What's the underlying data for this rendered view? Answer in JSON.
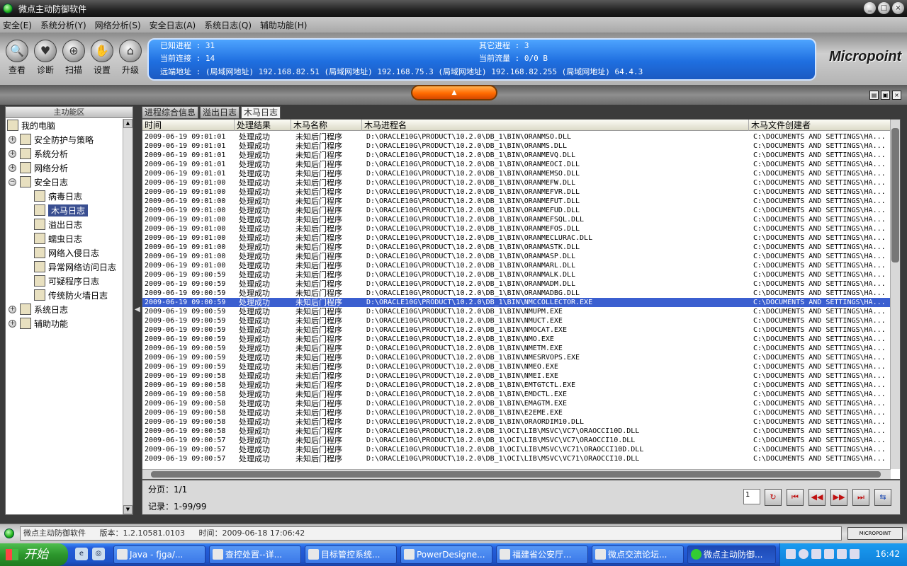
{
  "window": {
    "title": "微点主动防御软件",
    "buttons": [
      "_",
      "□",
      "×"
    ]
  },
  "menu": [
    "安全(E)",
    "系统分析(Y)",
    "网络分析(S)",
    "安全日志(A)",
    "系统日志(Q)",
    "辅助功能(H)"
  ],
  "toolbar": [
    {
      "label": "查看",
      "icon": "magnifier-icon",
      "glyph": "🔍"
    },
    {
      "label": "诊断",
      "icon": "heart-icon",
      "glyph": "♥"
    },
    {
      "label": "扫描",
      "icon": "scan-icon",
      "glyph": "⊕"
    },
    {
      "label": "设置",
      "icon": "hand-icon",
      "glyph": "✋"
    },
    {
      "label": "升级",
      "icon": "upgrade-icon",
      "glyph": "⌂"
    }
  ],
  "info": {
    "known_processes": "已知进程 : 31",
    "other_processes": "其它进程 : 3",
    "current_connections": "当前连接 : 14",
    "current_traffic": "当前流量 : 0/0 B",
    "remote_address": "远端地址 : (局域网地址)    192.168.82.51 (局域网地址)              192.168.75.3 (局域网地址)    192.168.82.255 (局域网地址)    64.4.3"
  },
  "logo": "Micropoint",
  "sidebar": {
    "header": "主功能区",
    "nodes": [
      {
        "label": "我的电脑",
        "level": 0,
        "expander": "",
        "icon": "computer-icon"
      },
      {
        "label": "安全防护与策略",
        "level": 1,
        "expander": "+",
        "icon": "shield-icon"
      },
      {
        "label": "系统分析",
        "level": 1,
        "expander": "+",
        "icon": "monitor-icon"
      },
      {
        "label": "网络分析",
        "level": 1,
        "expander": "+",
        "icon": "network-icon"
      },
      {
        "label": "安全日志",
        "level": 1,
        "expander": "−",
        "icon": "log-icon"
      },
      {
        "label": "病毒日志",
        "level": 2,
        "expander": "",
        "icon": "virus-icon"
      },
      {
        "label": "木马日志",
        "level": 2,
        "expander": "",
        "icon": "trojan-icon",
        "selected": true
      },
      {
        "label": "溢出日志",
        "level": 2,
        "expander": "",
        "icon": "overflow-icon"
      },
      {
        "label": "蠕虫日志",
        "level": 2,
        "expander": "",
        "icon": "worm-icon"
      },
      {
        "label": "网络入侵日志",
        "level": 2,
        "expander": "",
        "icon": "intrusion-icon"
      },
      {
        "label": "异常网络访问日志",
        "level": 2,
        "expander": "",
        "icon": "abnormal-access-icon"
      },
      {
        "label": "可疑程序日志",
        "level": 2,
        "expander": "",
        "icon": "suspicious-icon"
      },
      {
        "label": "传统防火墙日志",
        "level": 2,
        "expander": "",
        "icon": "firewall-icon"
      },
      {
        "label": "系统日志",
        "level": 1,
        "expander": "+",
        "icon": "system-log-icon"
      },
      {
        "label": "辅助功能",
        "level": 1,
        "expander": "+",
        "icon": "tools-icon"
      }
    ]
  },
  "tabs": [
    {
      "label": "进程综合信息",
      "active": false
    },
    {
      "label": "溢出日志",
      "active": false
    },
    {
      "label": "木马日志",
      "active": true
    }
  ],
  "table": {
    "columns": [
      "时间",
      "处理结果",
      "木马名称",
      "木马进程名",
      "木马文件创建者"
    ],
    "result": "处理成功",
    "name": "未知后门程序",
    "creator": "C:\\DOCUMENTS AND SETTINGS\\HA...",
    "selected_index": 18,
    "rows": [
      [
        "2009-06-19 09:01:01",
        "D:\\ORACLE10G\\PRODUCT\\10.2.0\\DB_1\\BIN\\ORANMSO.DLL"
      ],
      [
        "2009-06-19 09:01:01",
        "D:\\ORACLE10G\\PRODUCT\\10.2.0\\DB_1\\BIN\\ORANMS.DLL"
      ],
      [
        "2009-06-19 09:01:01",
        "D:\\ORACLE10G\\PRODUCT\\10.2.0\\DB_1\\BIN\\ORANMEVQ.DLL"
      ],
      [
        "2009-06-19 09:01:01",
        "D:\\ORACLE10G\\PRODUCT\\10.2.0\\DB_1\\BIN\\ORANMEOCI.DLL"
      ],
      [
        "2009-06-19 09:01:01",
        "D:\\ORACLE10G\\PRODUCT\\10.2.0\\DB_1\\BIN\\ORANMEMSO.DLL"
      ],
      [
        "2009-06-19 09:01:00",
        "D:\\ORACLE10G\\PRODUCT\\10.2.0\\DB_1\\BIN\\ORANMEFW.DLL"
      ],
      [
        "2009-06-19 09:01:00",
        "D:\\ORACLE10G\\PRODUCT\\10.2.0\\DB_1\\BIN\\ORANMEFVR.DLL"
      ],
      [
        "2009-06-19 09:01:00",
        "D:\\ORACLE10G\\PRODUCT\\10.2.0\\DB_1\\BIN\\ORANMEFUT.DLL"
      ],
      [
        "2009-06-19 09:01:00",
        "D:\\ORACLE10G\\PRODUCT\\10.2.0\\DB_1\\BIN\\ORANMEFUD.DLL"
      ],
      [
        "2009-06-19 09:01:00",
        "D:\\ORACLE10G\\PRODUCT\\10.2.0\\DB_1\\BIN\\ORANMEFSQL.DLL"
      ],
      [
        "2009-06-19 09:01:00",
        "D:\\ORACLE10G\\PRODUCT\\10.2.0\\DB_1\\BIN\\ORANMEFOS.DLL"
      ],
      [
        "2009-06-19 09:01:00",
        "D:\\ORACLE10G\\PRODUCT\\10.2.0\\DB_1\\BIN\\ORANMECLURAC.DLL"
      ],
      [
        "2009-06-19 09:01:00",
        "D:\\ORACLE10G\\PRODUCT\\10.2.0\\DB_1\\BIN\\ORANMASTK.DLL"
      ],
      [
        "2009-06-19 09:01:00",
        "D:\\ORACLE10G\\PRODUCT\\10.2.0\\DB_1\\BIN\\ORANMASP.DLL"
      ],
      [
        "2009-06-19 09:01:00",
        "D:\\ORACLE10G\\PRODUCT\\10.2.0\\DB_1\\BIN\\ORANMARL.DLL"
      ],
      [
        "2009-06-19 09:00:59",
        "D:\\ORACLE10G\\PRODUCT\\10.2.0\\DB_1\\BIN\\ORANMALK.DLL"
      ],
      [
        "2009-06-19 09:00:59",
        "D:\\ORACLE10G\\PRODUCT\\10.2.0\\DB_1\\BIN\\ORANMADM.DLL"
      ],
      [
        "2009-06-19 09:00:59",
        "D:\\ORACLE10G\\PRODUCT\\10.2.0\\DB_1\\BIN\\ORANMADBG.DLL"
      ],
      [
        "2009-06-19 09:00:59",
        "D:\\ORACLE10G\\PRODUCT\\10.2.0\\DB_1\\BIN\\NMCCOLLECTOR.EXE"
      ],
      [
        "2009-06-19 09:00:59",
        "D:\\ORACLE10G\\PRODUCT\\10.2.0\\DB_1\\BIN\\NMUPM.EXE"
      ],
      [
        "2009-06-19 09:00:59",
        "D:\\ORACLE10G\\PRODUCT\\10.2.0\\DB_1\\BIN\\NMUCT.EXE"
      ],
      [
        "2009-06-19 09:00:59",
        "D:\\ORACLE10G\\PRODUCT\\10.2.0\\DB_1\\BIN\\NMOCAT.EXE"
      ],
      [
        "2009-06-19 09:00:59",
        "D:\\ORACLE10G\\PRODUCT\\10.2.0\\DB_1\\BIN\\NMO.EXE"
      ],
      [
        "2009-06-19 09:00:59",
        "D:\\ORACLE10G\\PRODUCT\\10.2.0\\DB_1\\BIN\\NMETM.EXE"
      ],
      [
        "2009-06-19 09:00:59",
        "D:\\ORACLE10G\\PRODUCT\\10.2.0\\DB_1\\BIN\\NMESRVOPS.EXE"
      ],
      [
        "2009-06-19 09:00:59",
        "D:\\ORACLE10G\\PRODUCT\\10.2.0\\DB_1\\BIN\\NMEO.EXE"
      ],
      [
        "2009-06-19 09:00:58",
        "D:\\ORACLE10G\\PRODUCT\\10.2.0\\DB_1\\BIN\\NMEI.EXE"
      ],
      [
        "2009-06-19 09:00:58",
        "D:\\ORACLE10G\\PRODUCT\\10.2.0\\DB_1\\BIN\\EMTGTCTL.EXE"
      ],
      [
        "2009-06-19 09:00:58",
        "D:\\ORACLE10G\\PRODUCT\\10.2.0\\DB_1\\BIN\\EMDCTL.EXE"
      ],
      [
        "2009-06-19 09:00:58",
        "D:\\ORACLE10G\\PRODUCT\\10.2.0\\DB_1\\BIN\\EMAGTM.EXE"
      ],
      [
        "2009-06-19 09:00:58",
        "D:\\ORACLE10G\\PRODUCT\\10.2.0\\DB_1\\BIN\\E2EME.EXE"
      ],
      [
        "2009-06-19 09:00:58",
        "D:\\ORACLE10G\\PRODUCT\\10.2.0\\DB_1\\BIN\\ORAORDIM10.DLL"
      ],
      [
        "2009-06-19 09:00:58",
        "D:\\ORACLE10G\\PRODUCT\\10.2.0\\DB_1\\OCI\\LIB\\MSVC\\VC7\\ORAOCCI10D.DLL"
      ],
      [
        "2009-06-19 09:00:57",
        "D:\\ORACLE10G\\PRODUCT\\10.2.0\\DB_1\\OCI\\LIB\\MSVC\\VC7\\ORAOCCI10.DLL"
      ],
      [
        "2009-06-19 09:00:57",
        "D:\\ORACLE10G\\PRODUCT\\10.2.0\\DB_1\\OCI\\LIB\\MSVC\\VC71\\ORAOCCI10D.DLL"
      ],
      [
        "2009-06-19 09:00:57",
        "D:\\ORACLE10G\\PRODUCT\\10.2.0\\DB_1\\OCI\\LIB\\MSVC\\VC71\\ORAOCCI10.DLL"
      ]
    ]
  },
  "pager": {
    "page_text": "分页：1/1",
    "record_text": "记录：1-99/99",
    "page_input": "1",
    "buttons": [
      {
        "name": "refresh-button",
        "glyph": "↻"
      },
      {
        "name": "first-page-button",
        "glyph": "⏮"
      },
      {
        "name": "prev-page-button",
        "glyph": "◀◀"
      },
      {
        "name": "next-page-button",
        "glyph": "▶▶"
      },
      {
        "name": "last-page-button",
        "glyph": "⏭"
      },
      {
        "name": "export-button",
        "glyph": "⇆"
      }
    ]
  },
  "status": {
    "app": "微点主动防御软件",
    "version": "版本：1.2.10581.0103",
    "time": "时间：2009-06-18 17:06:42",
    "mini_logo": "MICROPOINT"
  },
  "taskbar": {
    "start": "开始",
    "tasks": [
      {
        "label": "Java - fjga/...",
        "active": false
      },
      {
        "label": "查控处置--详...",
        "active": false
      },
      {
        "label": "目标管控系统...",
        "active": false
      },
      {
        "label": "PowerDesigne...",
        "active": false
      },
      {
        "label": "福建省公安厅...",
        "active": false
      },
      {
        "label": "微点交流论坛...",
        "active": false
      },
      {
        "label": "微点主动防御...",
        "active": true
      }
    ],
    "clock": "16:42"
  }
}
